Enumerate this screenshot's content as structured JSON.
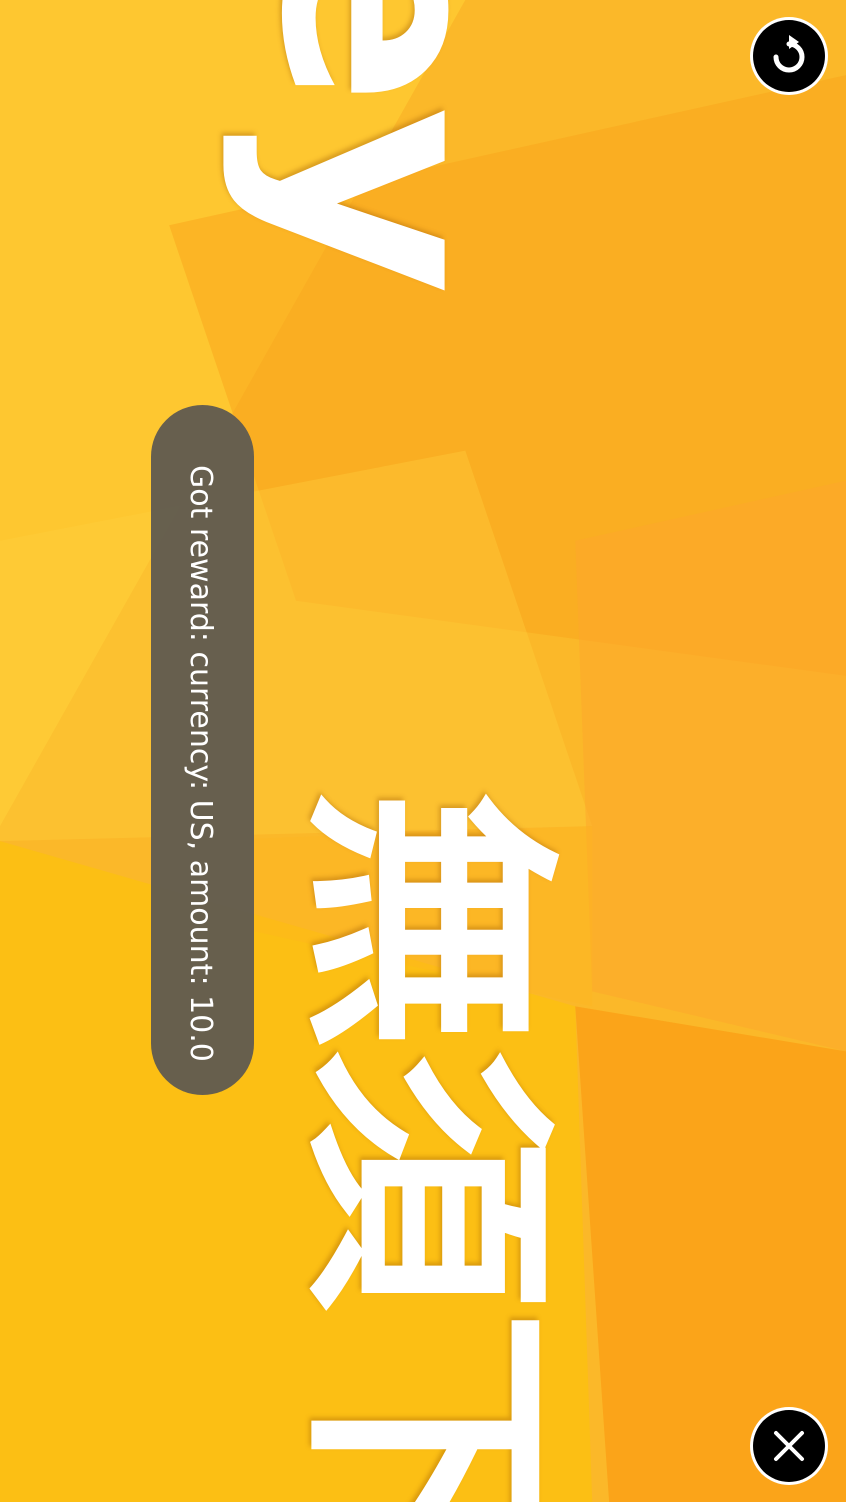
{
  "ad": {
    "headline_latin": "ey",
    "headline_cjk": "無須下",
    "background_color": "#FBB829",
    "text_color": "#FFFFFF"
  },
  "controls": {
    "refresh_icon": "refresh-icon",
    "close_icon": "close-icon"
  },
  "toast": {
    "message": "Got reward: currency: US, amount: 10.0",
    "background_color": "#625C50"
  }
}
